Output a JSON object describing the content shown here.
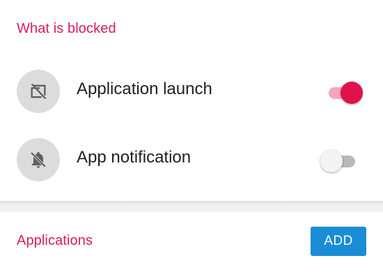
{
  "blocked_section": {
    "title": "What is blocked",
    "items": [
      {
        "label": "Application launch",
        "icon": "app-launch-blocked-icon",
        "enabled": true
      },
      {
        "label": "App notification",
        "icon": "notifications-off-icon",
        "enabled": false
      }
    ]
  },
  "applications_section": {
    "title": "Applications",
    "add_label": "ADD"
  },
  "colors": {
    "accent": "#d81b60",
    "switch_on_thumb": "#e0114b",
    "switch_on_track": "#f4a6c0",
    "add_button": "#1a8dd6"
  }
}
